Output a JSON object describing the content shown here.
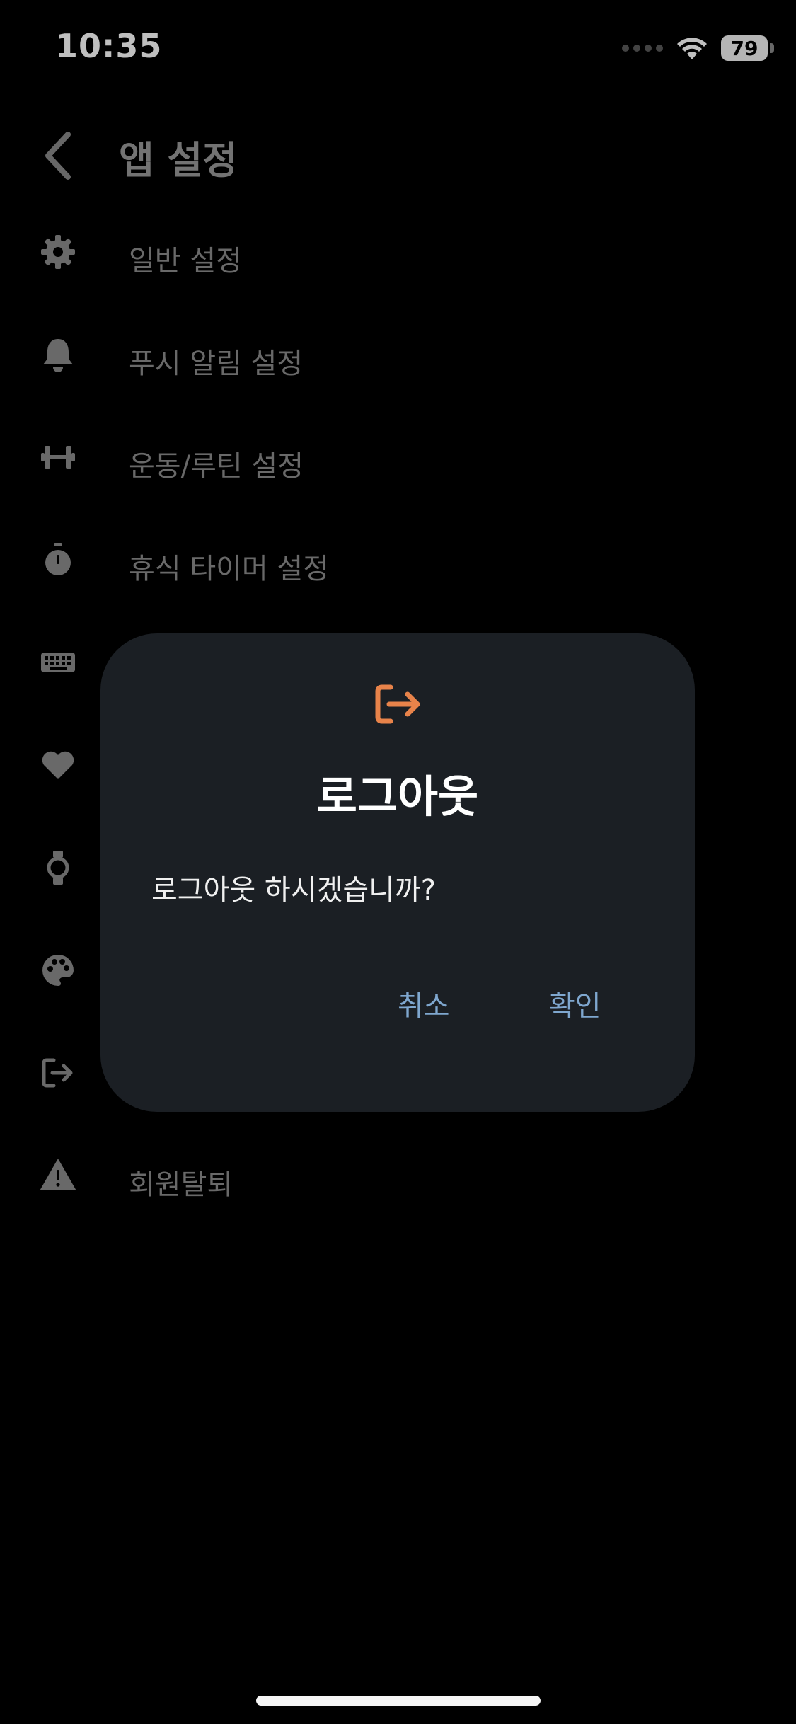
{
  "status_bar": {
    "time": "10:35",
    "battery_level": "79",
    "signal_icon": "signal-dots-icon",
    "wifi_icon": "wifi-icon"
  },
  "header": {
    "title": "앱 설정",
    "back_icon": "chevron-left-icon"
  },
  "settings": {
    "items": [
      {
        "label": "일반 설정",
        "icon": "gear-icon"
      },
      {
        "label": "푸시 알림 설정",
        "icon": "bell-icon"
      },
      {
        "label": "운동/루틴 설정",
        "icon": "dumbbell-icon"
      },
      {
        "label": "휴식 타이머 설정",
        "icon": "stopwatch-icon"
      },
      {
        "label": "",
        "icon": "keyboard-icon"
      },
      {
        "label": "",
        "icon": "heart-icon"
      },
      {
        "label": "",
        "icon": "watch-icon"
      },
      {
        "label": "",
        "icon": "palette-icon"
      },
      {
        "label": "",
        "icon": "logout-icon"
      },
      {
        "label": "회원탈퇴",
        "icon": "warning-icon"
      }
    ]
  },
  "dialog": {
    "icon": "logout-icon",
    "title": "로그아웃",
    "message": "로그아웃 하시겠습니까?",
    "cancel_label": "취소",
    "confirm_label": "확인"
  },
  "colors": {
    "background": "#000000",
    "dialog_background": "#1b1f24",
    "accent_orange": "#e8834a",
    "button_blue": "#7fa7cf",
    "muted_text": "#8c8c8c"
  }
}
